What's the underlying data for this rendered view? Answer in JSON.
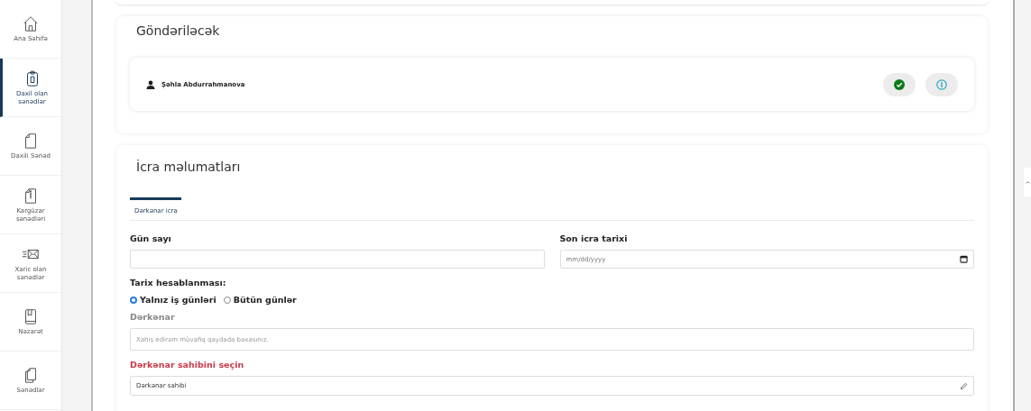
{
  "sidebar": {
    "items": [
      {
        "label": "Ana Səhifə",
        "kind": "home",
        "selected": false
      },
      {
        "label": "Daxil olan sənədlər",
        "kind": "clipboard",
        "selected": true
      },
      {
        "label": "Daxili Sənəd",
        "kind": "document",
        "selected": false
      },
      {
        "label": "Kargüzar sənədləri",
        "kind": "zip",
        "selected": false
      },
      {
        "label": "Xaric olan sənədlər",
        "kind": "mail",
        "selected": false
      },
      {
        "label": "Nəzarət",
        "kind": "book",
        "selected": false
      },
      {
        "label": "Sənədlər",
        "kind": "documents",
        "selected": false
      }
    ]
  },
  "recipients": {
    "title": "Göndəriləcək",
    "people": [
      {
        "name": "Şəhla Abdurrahmanova"
      }
    ]
  },
  "execution": {
    "title": "İcra məlumatları",
    "tabs": [
      {
        "label": "Dərkənar icra",
        "selected": true
      }
    ],
    "day_count": {
      "label": "Gün sayı"
    },
    "last_date": {
      "label": "Son icra tarixi",
      "placeholder": "mm/dd/yyyy"
    },
    "date_calc": {
      "label": "Tarix hesablanması:",
      "options": [
        {
          "label": "Yalnız iş günləri",
          "selected": true
        },
        {
          "label": "Bütün günlər",
          "selected": false
        }
      ]
    },
    "resolution": {
      "label": "Dərkənar",
      "placeholder": "Xahiş edirəm müvafiq qaydada baxasınız."
    },
    "owner": {
      "label": "Dərkənar sahibini seçin",
      "value": "Dərkənar sahibi"
    }
  }
}
